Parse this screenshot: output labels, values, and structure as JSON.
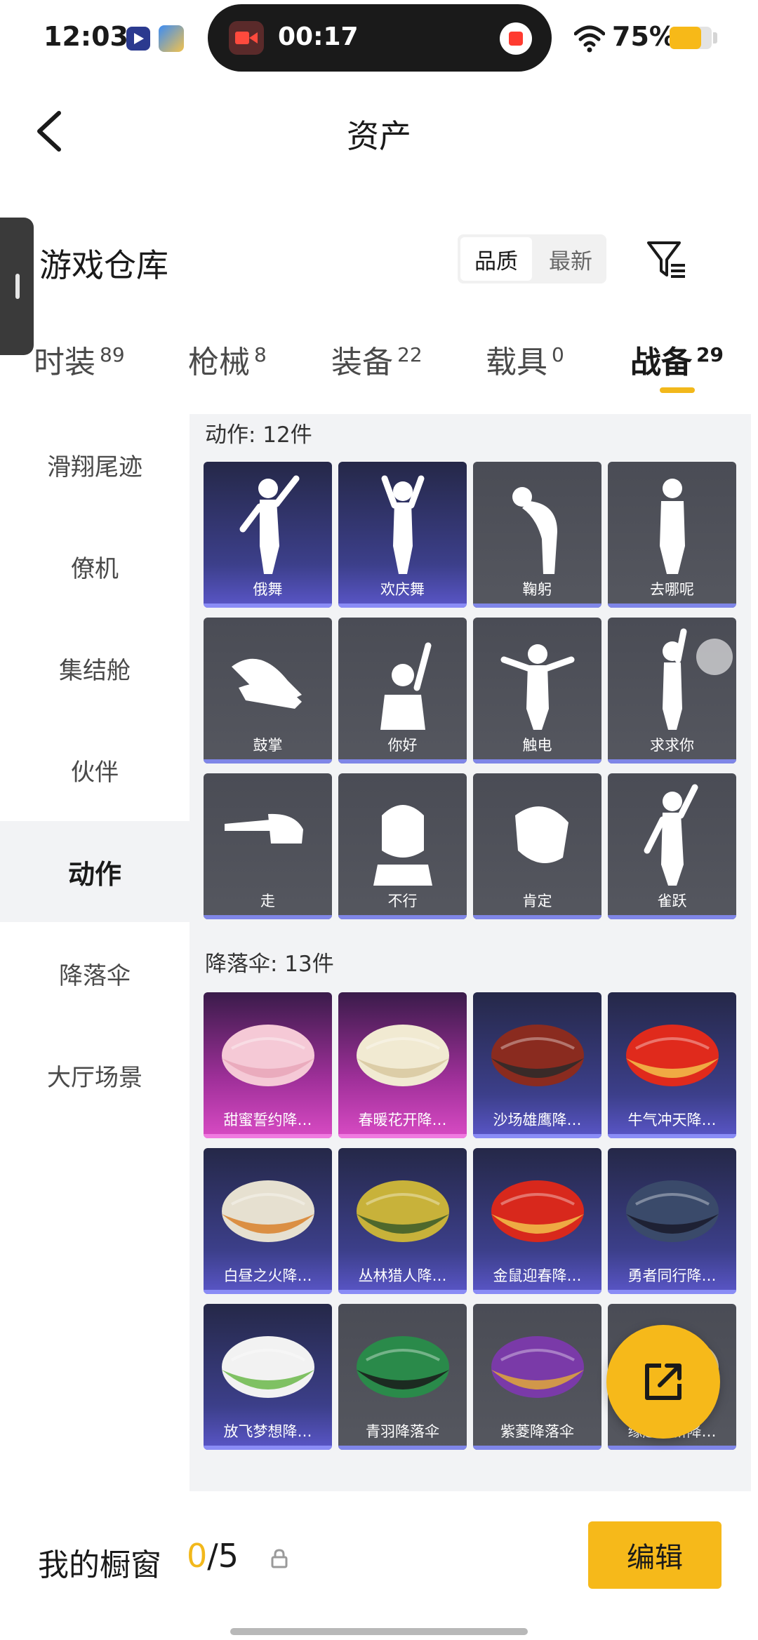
{
  "status": {
    "time": "12:03",
    "record_time": "00:17",
    "battery": "75%",
    "battery_level": 0.75
  },
  "header": {
    "title": "资产"
  },
  "section": {
    "title": "游戏仓库"
  },
  "sort": {
    "options": [
      "品质",
      "最新"
    ],
    "active": "品质"
  },
  "tabs": [
    {
      "label": "时装",
      "count": "89"
    },
    {
      "label": "枪械",
      "count": "8"
    },
    {
      "label": "装备",
      "count": "22"
    },
    {
      "label": "载具",
      "count": "0"
    },
    {
      "label": "战备",
      "count": "29",
      "active": true
    }
  ],
  "categories": [
    {
      "label": "滑翔尾迹"
    },
    {
      "label": "僚机"
    },
    {
      "label": "集结舱"
    },
    {
      "label": "伙伴"
    },
    {
      "label": "动作",
      "active": true
    },
    {
      "label": "降落伞"
    },
    {
      "label": "大厅场景"
    }
  ],
  "groups": {
    "emotes_label": "动作: 12件",
    "parachutes_label": "降落伞: 13件"
  },
  "emotes": [
    {
      "label": "俄舞",
      "style": "purple",
      "icon": "dance-figure-icon"
    },
    {
      "label": "欢庆舞",
      "style": "purple",
      "icon": "celebrate-figure-icon"
    },
    {
      "label": "鞠躬",
      "style": "gray",
      "icon": "bow-figure-icon"
    },
    {
      "label": "去哪呢",
      "style": "gray",
      "icon": "shrug-figure-icon"
    },
    {
      "label": "鼓掌",
      "style": "gray",
      "icon": "clap-hands-icon"
    },
    {
      "label": "你好",
      "style": "gray",
      "icon": "wave-figure-icon"
    },
    {
      "label": "触电",
      "style": "gray",
      "icon": "shock-figure-icon"
    },
    {
      "label": "求求你",
      "style": "gray",
      "icon": "beg-figure-icon"
    },
    {
      "label": "走",
      "style": "gray",
      "icon": "point-hand-icon"
    },
    {
      "label": "不行",
      "style": "gray",
      "icon": "no-head-icon"
    },
    {
      "label": "肯定",
      "style": "gray",
      "icon": "yes-head-icon"
    },
    {
      "label": "雀跃",
      "style": "gray",
      "icon": "cheer-figure-icon"
    }
  ],
  "parachutes": [
    {
      "label": "甜蜜誓约降…",
      "style": "pink",
      "colors": [
        "#f5c9d6",
        "#e7a6b8"
      ]
    },
    {
      "label": "春暖花开降…",
      "style": "pink",
      "colors": [
        "#f1ead2",
        "#d8c8a0"
      ]
    },
    {
      "label": "沙场雄鹰降…",
      "style": "purple",
      "colors": [
        "#8a2b1f",
        "#2a2a2a"
      ]
    },
    {
      "label": "牛气冲天降…",
      "style": "purple",
      "colors": [
        "#e02a1c",
        "#f2c14a"
      ]
    },
    {
      "label": "白昼之火降…",
      "style": "purple",
      "colors": [
        "#e6e0d0",
        "#d8802a"
      ]
    },
    {
      "label": "丛林猎人降…",
      "style": "purple",
      "colors": [
        "#c8b23a",
        "#3a5a2a"
      ]
    },
    {
      "label": "金鼠迎春降…",
      "style": "purple",
      "colors": [
        "#d8281c",
        "#f2c14a"
      ]
    },
    {
      "label": "勇者同行降…",
      "style": "purple",
      "colors": [
        "#3a4a6a",
        "#1a1a2a"
      ]
    },
    {
      "label": "放飞梦想降…",
      "style": "purple",
      "colors": [
        "#f2f2f2",
        "#6bb84a"
      ]
    },
    {
      "label": "青羽降落伞",
      "style": "gray",
      "colors": [
        "#2a8a4a",
        "#1a1a1a"
      ]
    },
    {
      "label": "紫菱降落伞",
      "style": "gray",
      "colors": [
        "#7a3aa8",
        "#e0a83a"
      ]
    },
    {
      "label": "缘起最新降…",
      "style": "gray",
      "colors": [
        "#d8c8a0",
        "#8a6a4a"
      ]
    }
  ],
  "bottom": {
    "showcase_label": "我的橱窗",
    "showcase_current": "0",
    "showcase_total": "/5",
    "edit_label": "编辑"
  },
  "colors": {
    "accent": "#f6b91a",
    "tab_indicator": "#f2b81b"
  }
}
